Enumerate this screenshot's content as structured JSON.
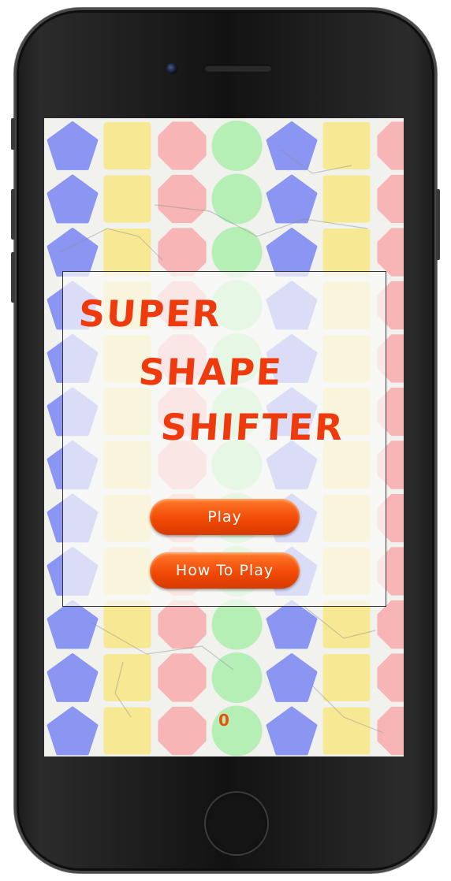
{
  "game": {
    "title_lines": [
      "SUPER",
      "SHAPE",
      "SHIFTER"
    ],
    "score": "0"
  },
  "menu": {
    "play_label": "Play",
    "how_to_play_label": "How To Play"
  },
  "board": {
    "rows": 12,
    "columns": [
      "pentagon",
      "square",
      "octagon",
      "circle",
      "pentagon",
      "square",
      "octagon"
    ],
    "colors": {
      "pentagon": "#8b95f2",
      "square": "#f7e994",
      "octagon": "#f7b5b5",
      "circle": "#b5efb5"
    }
  },
  "colors": {
    "title": "#ee3a0c",
    "button": "#f24a06",
    "score": "#e8520b"
  }
}
